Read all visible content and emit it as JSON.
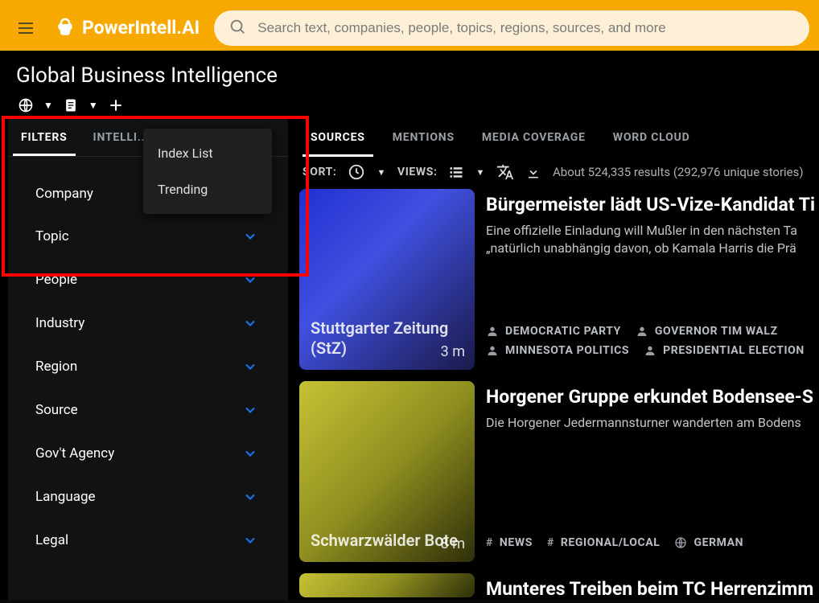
{
  "brand": "PowerIntell.AI",
  "search": {
    "placeholder": "Search text, companies, people, topics, regions, sources, and more"
  },
  "page_title": "Global Business Intelligence",
  "sidebar": {
    "tabs": [
      {
        "label": "FILTERS",
        "active": true
      },
      {
        "label": "INTELLI..."
      }
    ],
    "filters": [
      {
        "label": "Company"
      },
      {
        "label": "Topic"
      },
      {
        "label": "People"
      },
      {
        "label": "Industry"
      },
      {
        "label": "Region"
      },
      {
        "label": "Source"
      },
      {
        "label": "Gov't Agency"
      },
      {
        "label": "Language"
      },
      {
        "label": "Legal"
      }
    ]
  },
  "popup": {
    "items": [
      {
        "label": "Index List"
      },
      {
        "label": "Trending"
      }
    ]
  },
  "maintabs": [
    {
      "label": "SOURCES",
      "active": true
    },
    {
      "label": "MENTIONS"
    },
    {
      "label": "MEDIA COVERAGE"
    },
    {
      "label": "WORD CLOUD"
    }
  ],
  "toolbar": {
    "sort_label": "SORT:",
    "views_label": "VIEWS:",
    "results": "About 524,335 results (292,976 unique stories)"
  },
  "feed": [
    {
      "source": "Stuttgarter Zeitung (StZ)",
      "age": "3 m",
      "thumb_class": "thumb-blue",
      "title": "Bürgermeister lädt US-Vize-Kandidat Ti",
      "desc_line1": "Eine offizielle Einladung will Mußler in den nächsten Ta",
      "desc_line2": "„natürlich unabhängig davon, ob Kamala Harris die Prä",
      "tags": [
        {
          "icon": "person",
          "label": "DEMOCRATIC PARTY"
        },
        {
          "icon": "person",
          "label": "GOVERNOR TIM WALZ"
        },
        {
          "icon": "person",
          "label": "MINNESOTA POLITICS"
        },
        {
          "icon": "person",
          "label": "PRESIDENTIAL ELECTION"
        }
      ]
    },
    {
      "source": "Schwarzwälder Bote",
      "age": "8 m",
      "thumb_class": "thumb-olive",
      "title": "Horgener Gruppe erkundet Bodensee-S",
      "desc_line1": "Die Horgener Jedermannsturner wanderten am Bodens",
      "desc_line2": "",
      "tags": [
        {
          "icon": "hash",
          "label": "NEWS"
        },
        {
          "icon": "hash",
          "label": "REGIONAL/LOCAL"
        },
        {
          "icon": "globe",
          "label": "GERMAN"
        }
      ]
    },
    {
      "title": "Munteres Treiben beim TC Herrenzimm"
    }
  ]
}
